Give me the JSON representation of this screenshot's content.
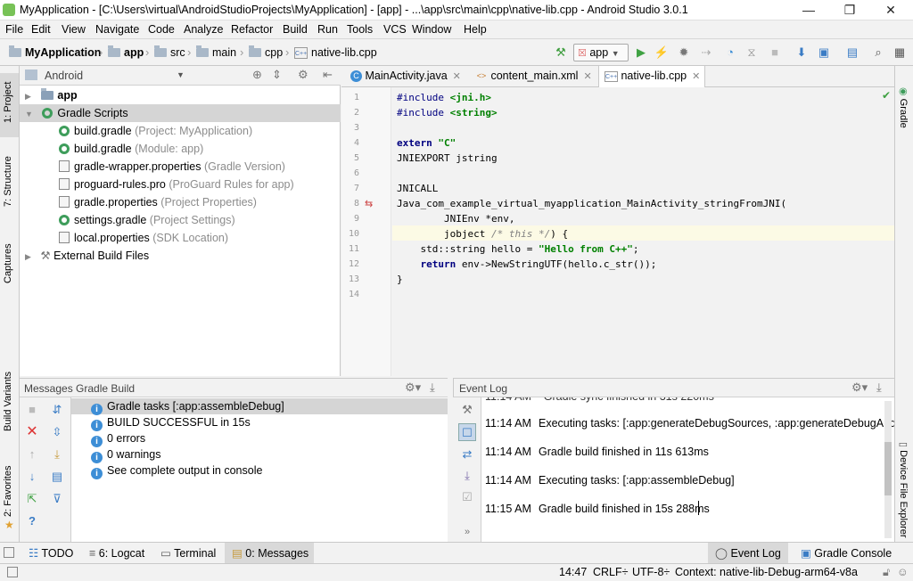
{
  "window": {
    "title": "MyApplication - [C:\\Users\\virtual\\AndroidStudioProjects\\MyApplication] - [app] - ...\\app\\src\\main\\cpp\\native-lib.cpp - Android Studio 3.0.1",
    "minimize": "—",
    "restore": "❐",
    "close": "✕"
  },
  "menu": [
    "File",
    "Edit",
    "View",
    "Navigate",
    "Code",
    "Analyze",
    "Refactor",
    "Build",
    "Run",
    "Tools",
    "VCS",
    "Window",
    "Help"
  ],
  "breadcrumbs": [
    "MyApplication",
    "app",
    "src",
    "main",
    "cpp",
    "native-lib.cpp"
  ],
  "run_config": "app",
  "project_panel": {
    "view": "Android",
    "tree": [
      {
        "label": "app",
        "hint": ""
      },
      {
        "label": "Gradle Scripts",
        "hint": ""
      },
      {
        "label": "build.gradle",
        "hint": "(Project: MyApplication)"
      },
      {
        "label": "build.gradle",
        "hint": "(Module: app)"
      },
      {
        "label": "gradle-wrapper.properties",
        "hint": "(Gradle Version)"
      },
      {
        "label": "proguard-rules.pro",
        "hint": "(ProGuard Rules for app)"
      },
      {
        "label": "gradle.properties",
        "hint": "(Project Properties)"
      },
      {
        "label": "settings.gradle",
        "hint": "(Project Settings)"
      },
      {
        "label": "local.properties",
        "hint": "(SDK Location)"
      },
      {
        "label": "External Build Files",
        "hint": ""
      }
    ]
  },
  "left_tool_windows": [
    "1: Project",
    "7: Structure",
    "Captures",
    "Build Variants",
    "2: Favorites"
  ],
  "right_tool_windows": [
    "Gradle",
    "Device File Explorer"
  ],
  "editor_tabs": [
    {
      "label": "MainActivity.java",
      "icon": "C"
    },
    {
      "label": "content_main.xml",
      "icon": "<>"
    },
    {
      "label": "native-lib.cpp",
      "icon": "C++"
    }
  ],
  "code": {
    "line_numbers": [
      "1",
      "2",
      "3",
      "4",
      "5",
      "6",
      "7",
      "8",
      "9",
      "10",
      "11",
      "12",
      "13",
      "14"
    ],
    "l1a": "#include ",
    "l1b": "<jni.h>",
    "l2a": "#include ",
    "l2b": "<string>",
    "l4a": "extern ",
    "l4b": "\"C\"",
    "l5": "JNIEXPORT jstring",
    "l7": "JNICALL",
    "l8": "Java_com_example_virtual_myapplication_MainActivity_stringFromJNI(",
    "l9": "        JNIEnv *env,",
    "l10a": "        jobject ",
    "l10b": "/* this */",
    "l10c": ") {",
    "l11a": "    std::string hello = ",
    "l11b": "\"Hello from C++\"",
    "l11c": ";",
    "l12a": "    ",
    "l12b": "return",
    "l12c": " env->NewStringUTF(hello.c_str());",
    "l13": "}"
  },
  "messages_panel": {
    "title": "Messages Gradle Build",
    "items": [
      "Gradle tasks [:app:assembleDebug]",
      "BUILD SUCCESSFUL in 15s",
      "0 errors",
      "0 warnings",
      "See complete output in console"
    ]
  },
  "event_log": {
    "title": "Event Log",
    "entries": [
      {
        "time": "11:14 AM",
        "text": "Executing tasks: [:app:generateDebugSources, :app:generateDebugAndroidT"
      },
      {
        "time": "11:14 AM",
        "text": "Gradle build finished in 11s 613ms"
      },
      {
        "time": "11:14 AM",
        "text": "Executing tasks: [:app:assembleDebug]"
      },
      {
        "time": "11:15 AM",
        "text": "Gradle build finished in 15s 288ms"
      }
    ]
  },
  "bottom_tabs": {
    "todo": "TODO",
    "logcat": "6: Logcat",
    "terminal": "Terminal",
    "messages": "0: Messages",
    "event_log": "Event Log",
    "gradle_console": "Gradle Console"
  },
  "status": {
    "position": "14:47",
    "line_sep": "CRLF÷",
    "encoding": "UTF-8÷",
    "context": "Context: native-lib-Debug-arm64-v8a"
  }
}
